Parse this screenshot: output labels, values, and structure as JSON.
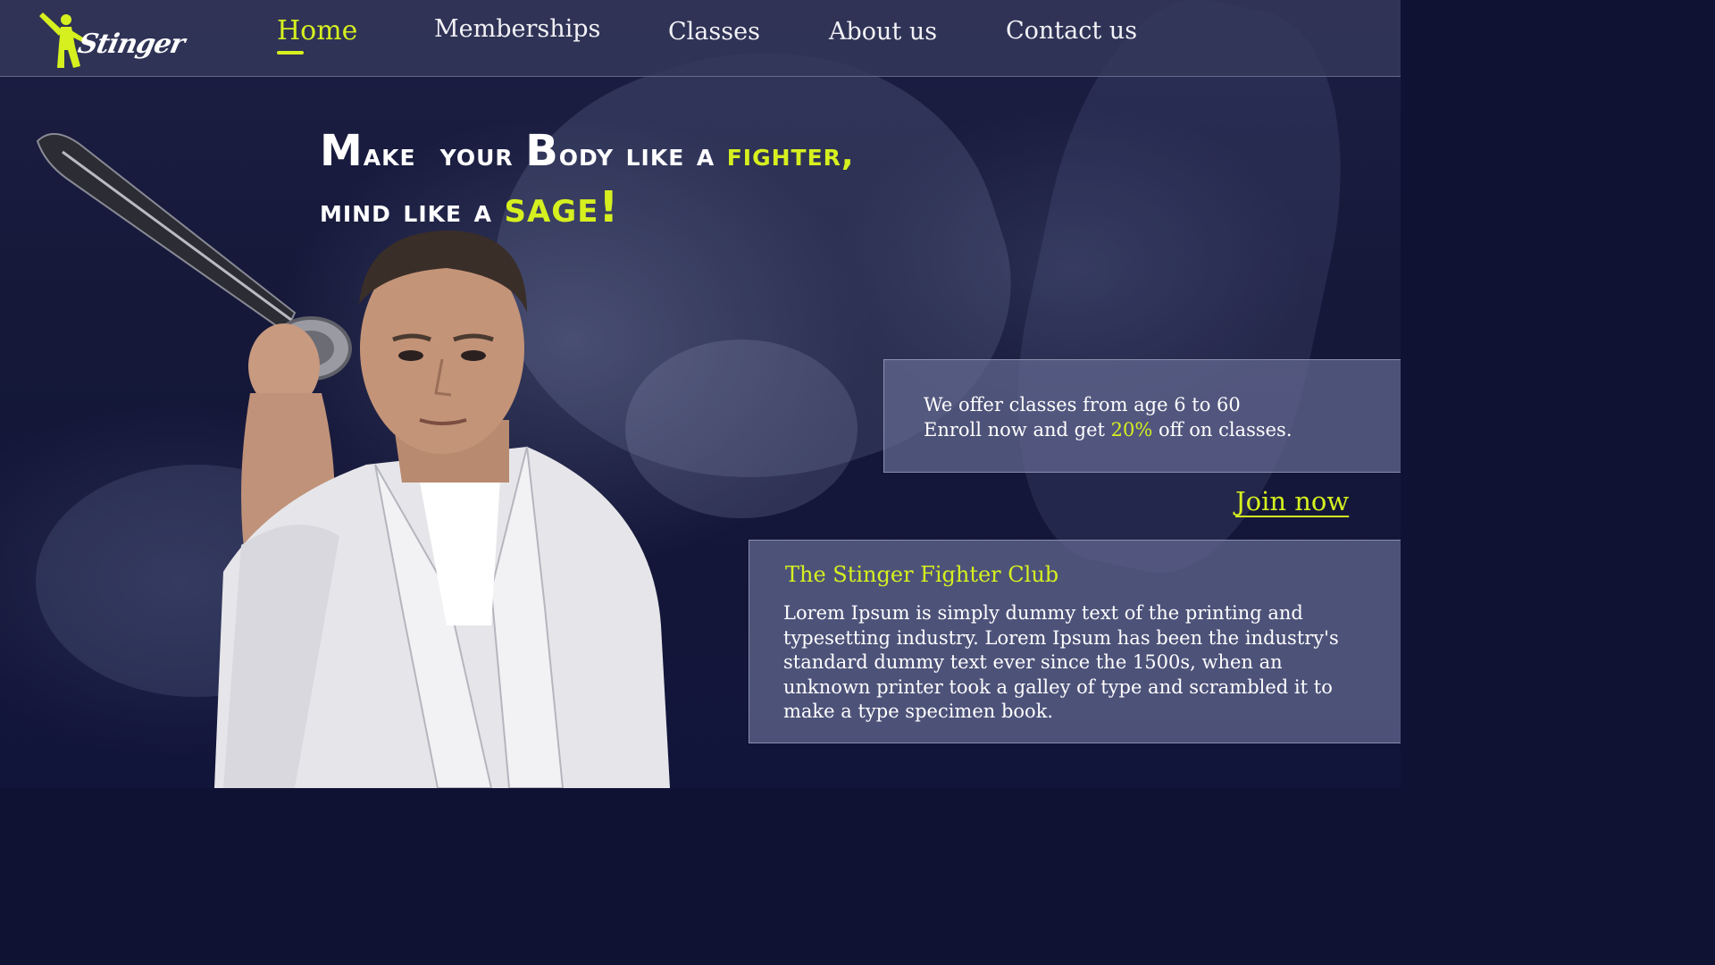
{
  "brand": {
    "name": "Stinger",
    "accent_color": "#d6f01f",
    "background_color": "#1a1d40"
  },
  "nav": {
    "items": [
      {
        "label": "Home",
        "active": true
      },
      {
        "label": "Memberships",
        "active": false
      },
      {
        "label": "Classes",
        "active": false
      },
      {
        "label": "About us",
        "active": false
      },
      {
        "label": "Contact us",
        "active": false
      }
    ]
  },
  "hero": {
    "headline": {
      "line1_part1_big": "M",
      "line1_part1_rest": "ake  your ",
      "line1_part2_big": "B",
      "line1_part2_rest": "ody like a ",
      "line1_accent": "fighter,",
      "line2_text": "mind like a ",
      "line2_accent": "sage!"
    },
    "image_icon": "martial-arts-master-with-sword"
  },
  "offer": {
    "line1": "We offer classes from age 6 to 60",
    "line2_before": "Enroll now and get ",
    "line2_highlight": "20%",
    "line2_after": " off on classes."
  },
  "cta": {
    "join_label": "Join now"
  },
  "club": {
    "title": "The Stinger Fighter Club",
    "description": "Lorem Ipsum is simply dummy text of the printing and typesetting industry. Lorem Ipsum has been the industry's standard dummy text ever since the 1500s, when an unknown printer took a galley of type and scrambled it to make a type specimen book."
  }
}
